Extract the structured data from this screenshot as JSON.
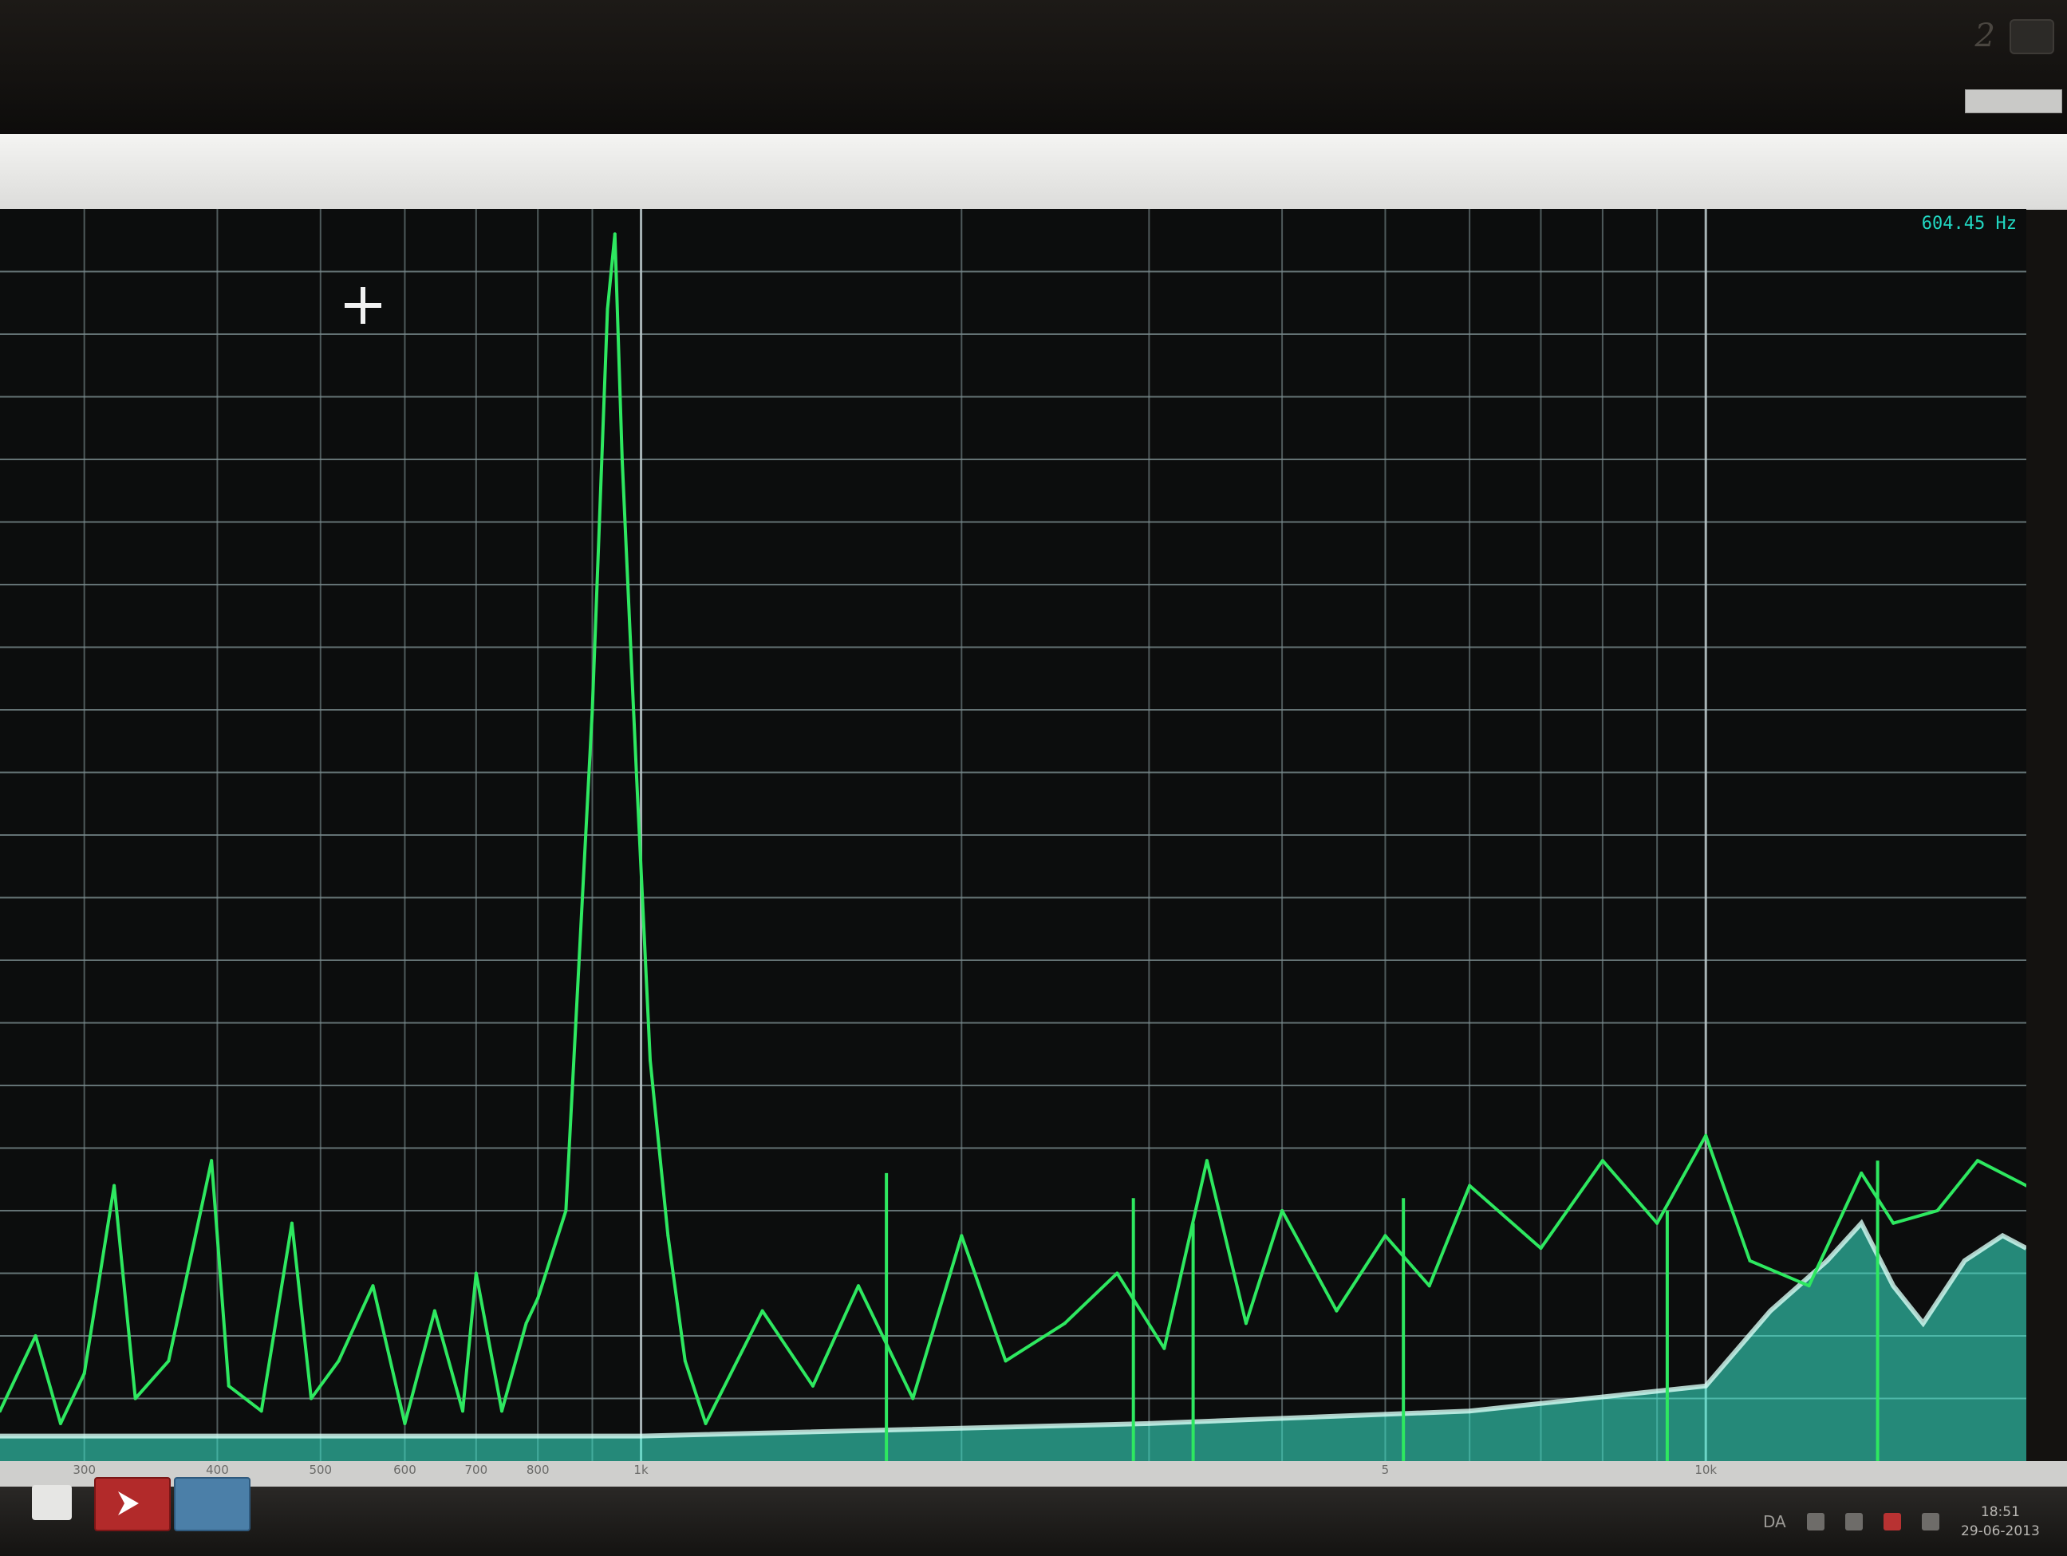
{
  "window": {
    "cursor_readout": "604.45 Hz"
  },
  "chart_data": {
    "type": "line",
    "title": "",
    "xlabel": "",
    "ylabel": "",
    "x_scale": "log",
    "xlim": [
      250,
      20000
    ],
    "ylim": [
      0,
      100
    ],
    "grid": true,
    "series_color": "#2ee860",
    "noise_color": "#3af0d4",
    "tick_labels": [
      {
        "label": "300",
        "x": 300
      },
      {
        "label": "400",
        "x": 400
      },
      {
        "label": "500",
        "x": 500
      },
      {
        "label": "600",
        "x": 600
      },
      {
        "label": "700",
        "x": 700
      },
      {
        "label": "800",
        "x": 800
      },
      {
        "label": "1k",
        "x": 1000
      },
      {
        "label": "5",
        "x": 5000
      },
      {
        "label": "10k",
        "x": 10000
      }
    ],
    "series": [
      {
        "name": "",
        "points": [
          [
            250,
            4
          ],
          [
            270,
            10
          ],
          [
            285,
            3
          ],
          [
            300,
            7
          ],
          [
            320,
            22
          ],
          [
            335,
            5
          ],
          [
            360,
            8
          ],
          [
            395,
            24
          ],
          [
            410,
            6
          ],
          [
            440,
            4
          ],
          [
            470,
            19
          ],
          [
            490,
            5
          ],
          [
            520,
            8
          ],
          [
            560,
            14
          ],
          [
            600,
            3
          ],
          [
            640,
            12
          ],
          [
            680,
            4
          ],
          [
            700,
            15
          ],
          [
            740,
            4
          ],
          [
            780,
            11
          ],
          [
            800,
            13
          ],
          [
            850,
            20
          ],
          [
            900,
            60
          ],
          [
            930,
            92
          ],
          [
            945,
            98
          ],
          [
            960,
            80
          ],
          [
            990,
            55
          ],
          [
            1020,
            32
          ],
          [
            1060,
            18
          ],
          [
            1100,
            8
          ],
          [
            1150,
            3
          ],
          [
            1300,
            12
          ],
          [
            1450,
            6
          ],
          [
            1600,
            14
          ],
          [
            1800,
            5
          ],
          [
            2000,
            18
          ],
          [
            2200,
            8
          ],
          [
            2500,
            11
          ],
          [
            2800,
            15
          ],
          [
            3100,
            9
          ],
          [
            3400,
            24
          ],
          [
            3700,
            11
          ],
          [
            4000,
            20
          ],
          [
            4500,
            12
          ],
          [
            5000,
            18
          ],
          [
            5500,
            14
          ],
          [
            6000,
            22
          ],
          [
            7000,
            17
          ],
          [
            8000,
            24
          ],
          [
            9000,
            19
          ],
          [
            10000,
            26
          ],
          [
            11000,
            16
          ],
          [
            12500,
            14
          ],
          [
            14000,
            23
          ],
          [
            15000,
            19
          ],
          [
            16500,
            20
          ],
          [
            18000,
            24
          ],
          [
            20000,
            22
          ]
        ]
      }
    ],
    "spikes": [
      {
        "x": 1700,
        "y": 23
      },
      {
        "x": 2900,
        "y": 21
      },
      {
        "x": 3300,
        "y": 19
      },
      {
        "x": 5200,
        "y": 21
      },
      {
        "x": 9200,
        "y": 20
      },
      {
        "x": 14500,
        "y": 24
      }
    ],
    "noise_floor": [
      [
        250,
        2
      ],
      [
        1000,
        2
      ],
      [
        3000,
        3
      ],
      [
        6000,
        4
      ],
      [
        10000,
        6
      ],
      [
        11500,
        12
      ],
      [
        13000,
        16
      ],
      [
        14000,
        19
      ],
      [
        15000,
        14
      ],
      [
        16000,
        11
      ],
      [
        17500,
        16
      ],
      [
        19000,
        18
      ],
      [
        20000,
        17
      ]
    ]
  },
  "taskbar": {
    "tray_lang": "DA",
    "clock_time": "18:51",
    "clock_date": "29-06-2013"
  }
}
